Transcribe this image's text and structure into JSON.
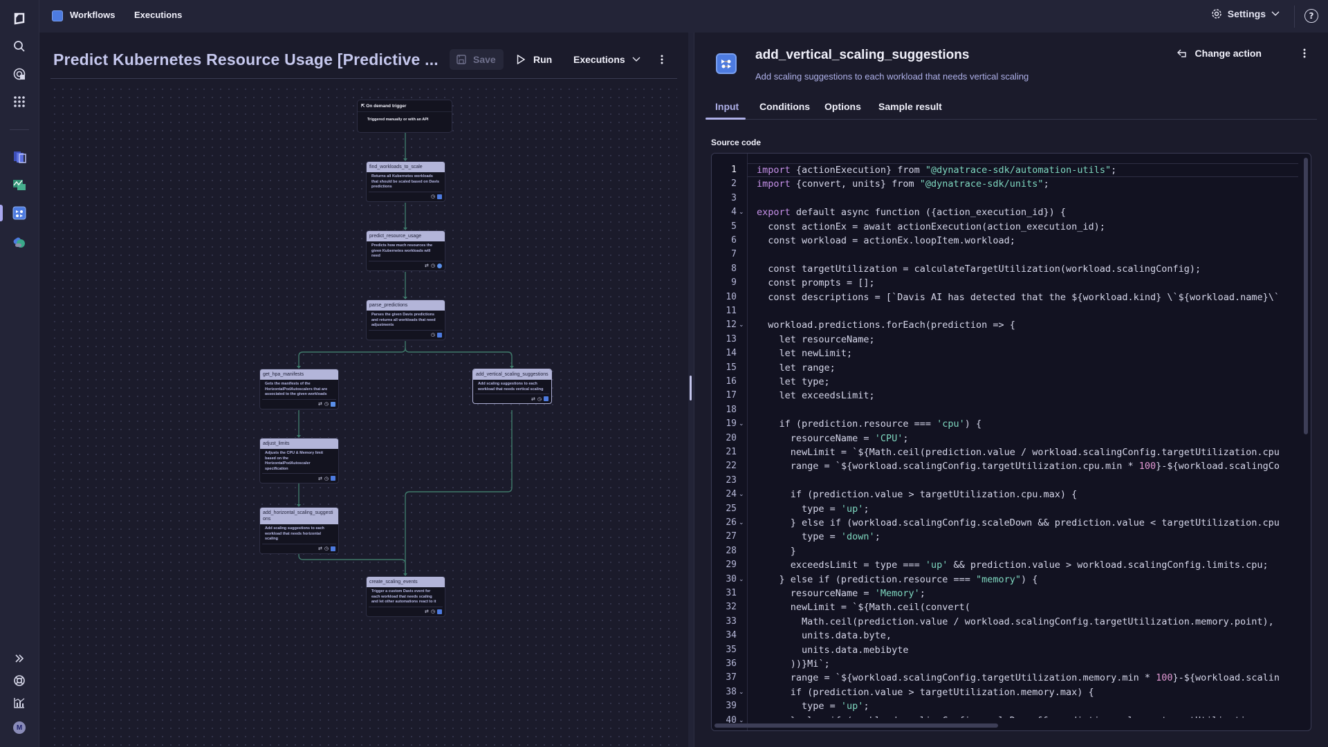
{
  "topbar": {
    "app_icon": "workflows-app-icon",
    "tabs": [
      "Workflows",
      "Executions"
    ],
    "settings_label": "Settings",
    "help_icon": "help-icon"
  },
  "rail": {
    "icons": [
      "dynatrace-logo-icon",
      "search-icon",
      "explore-icon",
      "apps-grid-icon",
      "kubernetes-app-icon",
      "dashboards-app-icon",
      "workflows-app-icon",
      "notebooks-app-icon"
    ],
    "bottom_icons": [
      "expand-icon",
      "support-icon",
      "whats-new-icon",
      "user-avatar"
    ],
    "avatar_initial": "M"
  },
  "workflow": {
    "title": "Predict Kubernetes Resource Usage [Predictive ...",
    "save_label": "Save",
    "run_label": "Run",
    "executions_label": "Executions",
    "trigger": {
      "title": "On demand trigger",
      "desc": "Triggered manually or with an API"
    },
    "nodes": [
      {
        "name": "find_workloads_to_scale",
        "desc": "Returns all Kubernetes workloads that should be scaled based on Davis predictions"
      },
      {
        "name": "predict_resource_usage",
        "desc": "Predicts how much resources the given Kubernetes workloads will need"
      },
      {
        "name": "parse_predictions",
        "desc": "Parses the given Davis predictions and returns all workloads that need adjustments"
      },
      {
        "name": "get_hpa_manifests",
        "desc": "Gets the manifests of the HorizontalPodAutoscalers that are associated to the given workloads"
      },
      {
        "name": "add_vertical_scaling_suggestions",
        "desc": "Add scaling suggestions to each workload that needs vertical scaling"
      },
      {
        "name": "adjust_limits",
        "desc": "Adjusts the CPU & Memory limit based on the HorizontalPodAutoscaler specification"
      },
      {
        "name": "add_horizontal_scaling_suggestions",
        "desc": "Add scaling suggestions to each workload that needs horizontal scaling"
      },
      {
        "name": "create_scaling_events",
        "desc": "Trigger a custom Davis event for each workload that needs scaling and let other automations react to it"
      }
    ]
  },
  "action": {
    "title": "add_vertical_scaling_suggestions",
    "desc": "Add scaling suggestions to each workload that needs vertical scaling",
    "change_label": "Change action",
    "tabs": [
      "Input",
      "Conditions",
      "Options",
      "Sample result"
    ],
    "active_tab": "Input",
    "source_label": "Source code"
  },
  "code": {
    "current_line": 1,
    "fold_lines": [
      4,
      12,
      19,
      24,
      26,
      30,
      38,
      40
    ],
    "lines": [
      "import {actionExecution} from \"@dynatrace-sdk/automation-utils\";",
      "import {convert, units} from \"@dynatrace-sdk/units\";",
      "",
      "export default async function ({action_execution_id}) {",
      "  const actionEx = await actionExecution(action_execution_id);",
      "  const workload = actionEx.loopItem.workload;",
      "",
      "  const targetUtilization = calculateTargetUtilization(workload.scalingConfig);",
      "  const prompts = [];",
      "  const descriptions = [`Davis AI has detected that the ${workload.kind} \\`${workload.name}\\`",
      "",
      "  workload.predictions.forEach(prediction => {",
      "    let resourceName;",
      "    let newLimit;",
      "    let range;",
      "    let type;",
      "    let exceedsLimit;",
      "",
      "    if (prediction.resource === 'cpu') {",
      "      resourceName = 'CPU';",
      "      newLimit = `${Math.ceil(prediction.value / workload.scalingConfig.targetUtilization.cpu",
      "      range = `${workload.scalingConfig.targetUtilization.cpu.min * 100}-${workload.scalingCo",
      "",
      "      if (prediction.value > targetUtilization.cpu.max) {",
      "        type = 'up';",
      "      } else if (workload.scalingConfig.scaleDown && prediction.value < targetUtilization.cpu",
      "        type = 'down';",
      "      }",
      "      exceedsLimit = type === 'up' && prediction.value > workload.scalingConfig.limits.cpu;",
      "    } else if (prediction.resource === \"memory\") {",
      "      resourceName = 'Memory';",
      "      newLimit = `${Math.ceil(convert(",
      "        Math.ceil(prediction.value / workload.scalingConfig.targetUtilization.memory.point),",
      "        units.data.byte,",
      "        units.data.mebibyte",
      "      ))}Mi`;",
      "      range = `${workload.scalingConfig.targetUtilization.memory.min * 100}-${workload.scalin",
      "      if (prediction.value > targetUtilization.memory.max) {",
      "        type = 'up';",
      "      } else if (workload.scalingConfig.scaleDown && prediction.value < targetUtilization.mem"
    ]
  },
  "colors": {
    "accent": "#aeb0e8",
    "app_blue": "#4d7be0",
    "edge": "#3f7a6b",
    "keyword": "#c792ea",
    "string": "#7fd8c0"
  }
}
